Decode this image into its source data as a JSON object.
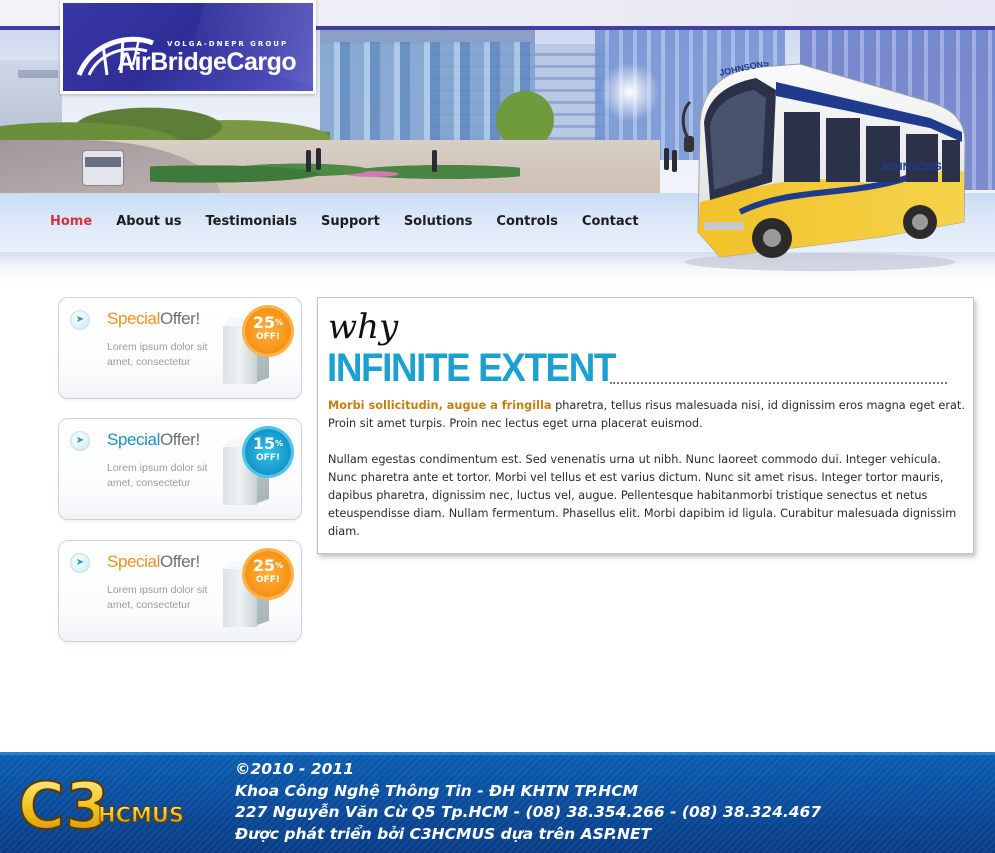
{
  "brand": {
    "tagline": "VOLGA-DNEPR GROUP",
    "name": "AirBridgeCargo",
    "bus_livery": "JOHNSONS"
  },
  "nav": {
    "items": [
      "Home",
      "About us",
      "Testimonials",
      "Support",
      "Solutions",
      "Controls",
      "Contact"
    ],
    "active": "Home"
  },
  "offers": [
    {
      "word1": "Special",
      "word2": "Offer!",
      "description": "Lorem ipsum dolor sit amet, consectetur",
      "percent": "25",
      "percent_sign": "%",
      "off": "OFF!",
      "badge_color": "#f7901a",
      "title_color": "#f0901e"
    },
    {
      "word1": "Special",
      "word2": "Offer!",
      "description": "Lorem ipsum dolor sit amet, consectetur",
      "percent": "15",
      "percent_sign": "%",
      "off": "OFF!",
      "badge_color": "#1590c9",
      "title_color": "#1d8fc1"
    },
    {
      "word1": "Special",
      "word2": "Offer!",
      "description": "Lorem ipsum dolor sit amet, consectetur",
      "percent": "25",
      "percent_sign": "%",
      "off": "OFF!",
      "badge_color": "#f7901a",
      "title_color": "#f0901e"
    }
  ],
  "content": {
    "kicker": "why",
    "headline": "INFINITE EXTENT",
    "highlight": "Morbi sollicitudin, augue a fringilla",
    "para1_rest": " pharetra, tellus risus malesuada nisi, id dignissim eros magna eget erat. Proin sit amet turpis. Proin nec lectus eget urna placerat euismod.",
    "para2": "Nullam egestas condimentum est. Sed venenatis urna ut nibh. Nunc laoreet commodo dui. Integer vehicula. Nunc pharetra ante et tortor. Morbi vel tellus et est varius dictum. Nunc sit amet risus. Integer tortor mauris, dapibus pharetra, dignissim nec, luctus vel, augue. Pellentesque habitanmorbi tristique senectus et netus eteuspendisse diam. Nullam fermentum. Phasellus elit. Morbi dapibim id ligula. Curabitur malesuada dignissim diam."
  },
  "footer": {
    "logo_letters": "C3",
    "logo_text": "HCMUS",
    "line1": "©2010 - 2011",
    "line2": "Khoa Công Nghệ Thông Tin - ĐH KHTN TP.HCM",
    "line3": "227 Nguyễn Văn Cừ Q5 Tp.HCM - (08) 38.354.266 - (08) 38.324.467",
    "line4": "Được phát triển bởi C3HCMUS dựa trên ASP.NET"
  },
  "colors": {
    "accent_blue": "#1ba0cf",
    "nav_active": "#d4333c",
    "highlight_text": "#c47e12",
    "footer_bg": "#0a4fa0",
    "logo_bg": "#3837a6"
  }
}
